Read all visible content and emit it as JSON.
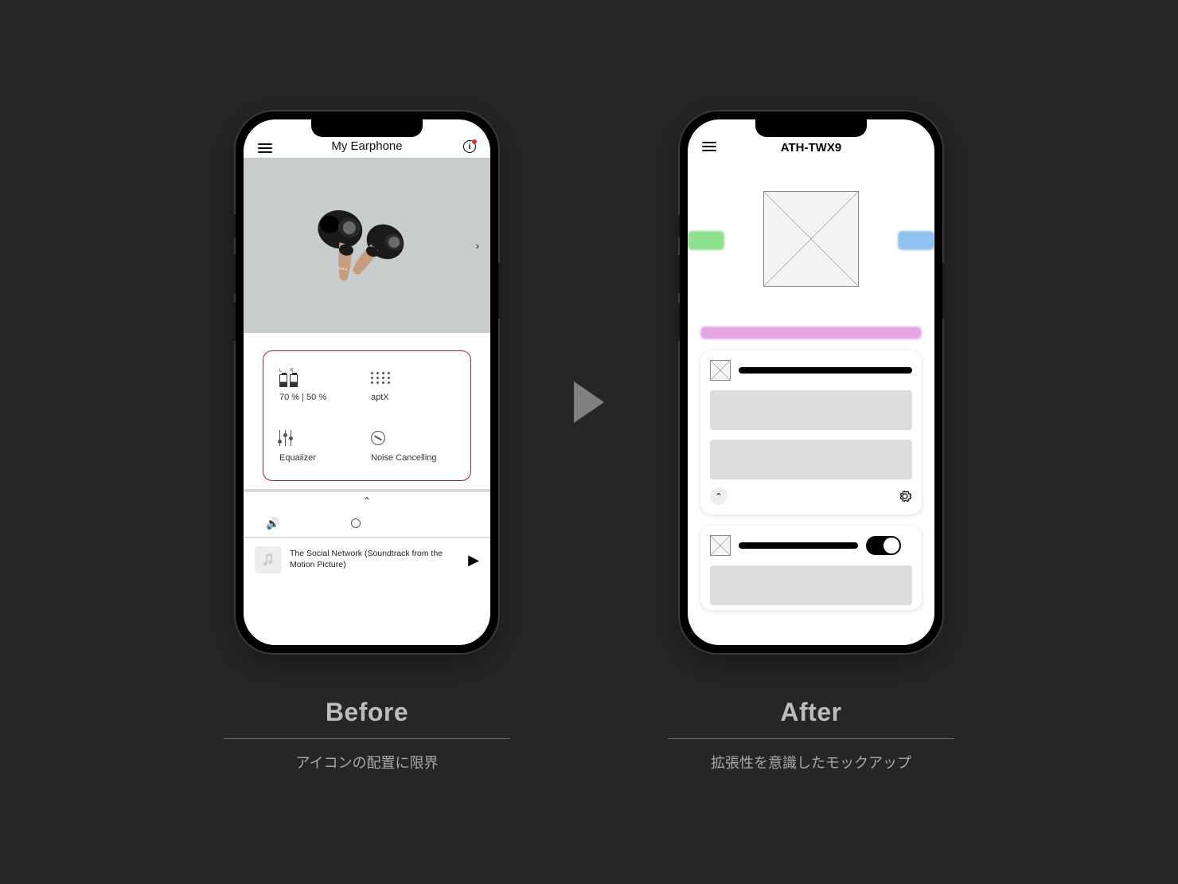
{
  "before": {
    "header_title": "My Earphone",
    "status": {
      "battery": "70 % | 50 %",
      "codec": "aptX",
      "equalizer": "Equaiizer",
      "noise_cancelling": "Noise Cancelling"
    },
    "now_playing": "The Social Network (Soundtrack from the Motion Picture)",
    "label_title": "Before",
    "label_sub": "アイコンの配置に限界"
  },
  "after": {
    "header_title": "ATH-TWX9",
    "label_title": "After",
    "label_sub": "拡張性を意識したモックアップ",
    "colors": {
      "chip_left": "#8ee08e",
      "chip_right": "#8fc2ef",
      "bar": "#e6a6e6"
    }
  }
}
